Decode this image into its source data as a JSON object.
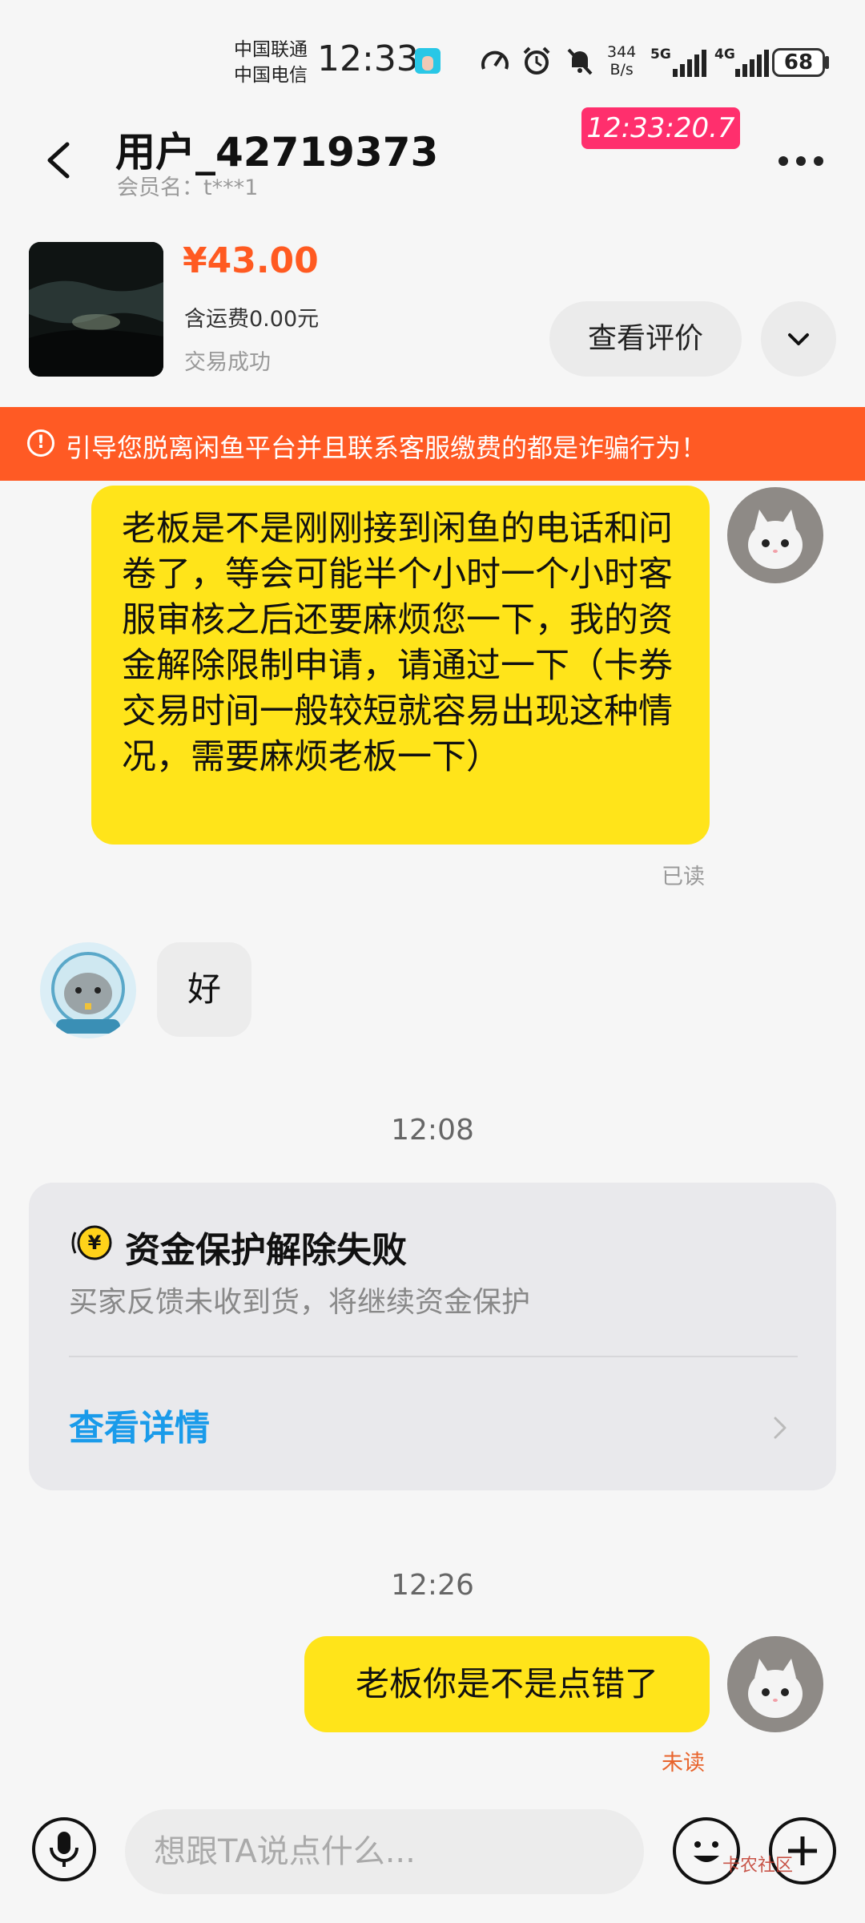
{
  "status_bar": {
    "carrier_1": "中国联通",
    "carrier_2": "中国电信",
    "time": "12:33",
    "net_speed_value": "344",
    "net_speed_unit": "B/s",
    "net_type_1": "5G",
    "net_type_2": "4G",
    "battery": "68"
  },
  "header": {
    "user_name": "用户_42719373",
    "member_name": "会员名：t***1",
    "timer": "12:33:20.7"
  },
  "product": {
    "price": "¥43.00",
    "shipping": "含运费0.00元",
    "status": "交易成功",
    "review_button": "查看评价"
  },
  "warning": {
    "text": "引导您脱离闲鱼平台并且联系客服缴费的都是诈骗行为！"
  },
  "messages": [
    {
      "text": "老板是不是刚刚接到闲鱼的电话和问卷了，等会可能半个小时一个小时客服审核之后还要麻烦您一下，我的资金解除限制申请，请通过一下（卡券交易时间一般较短就容易出现这种情况，需要麻烦老板一下）",
      "read_status": "已读"
    },
    {
      "text": "好"
    },
    {
      "time": "12:08"
    },
    {
      "card_title": "资金保护解除失败",
      "card_subtitle": "买家反馈未收到货，将继续资金保护",
      "card_link": "查看详情"
    },
    {
      "time": "12:26"
    },
    {
      "text": "老板你是不是点错了",
      "read_status": "未读"
    }
  ],
  "input": {
    "placeholder": "想跟TA说点什么..."
  },
  "watermark": "卡农社区",
  "colors": {
    "accent_orange": "#ff5a24",
    "price_orange": "#ff5a21",
    "bubble_yellow": "#ffe41a",
    "link_blue": "#1a9bea",
    "timer_pink": "#ff2f6d"
  }
}
